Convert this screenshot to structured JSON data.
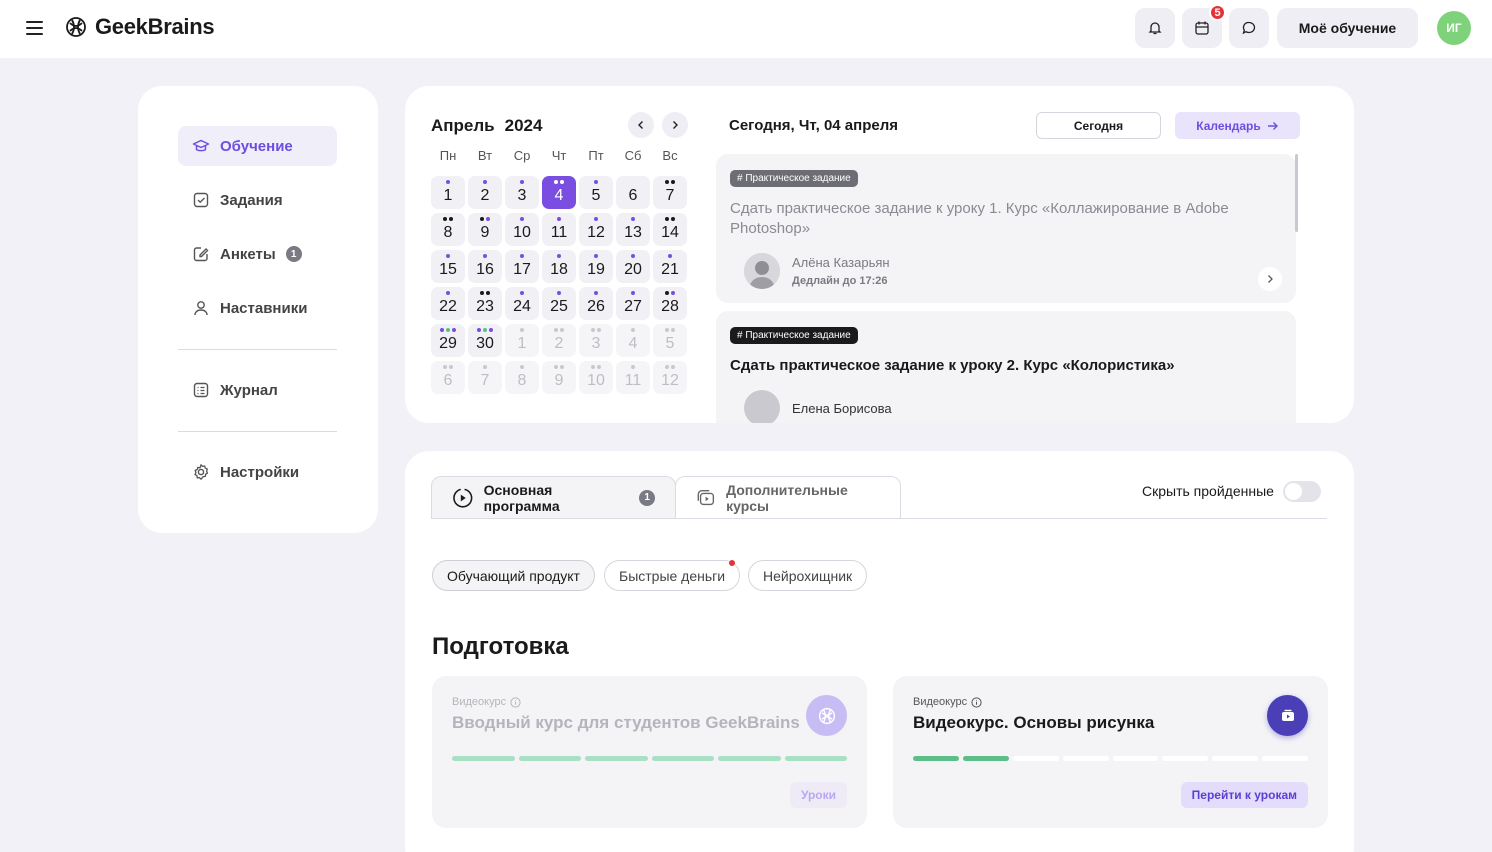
{
  "header": {
    "logo_text": "GeekBrains",
    "notifications_badge": "5",
    "my_learning_label": "Моё обучение",
    "avatar_initials": "ИГ"
  },
  "sidebar": {
    "items": [
      {
        "label": "Обучение",
        "icon": "graduation-cap-icon",
        "active": true
      },
      {
        "label": "Задания",
        "icon": "checkbox-icon"
      },
      {
        "label": "Анкеты",
        "icon": "edit-icon",
        "count": "1"
      },
      {
        "label": "Наставники",
        "icon": "user-icon"
      },
      {
        "label": "Журнал",
        "icon": "journal-icon"
      },
      {
        "label": "Настройки",
        "icon": "gear-icon"
      }
    ]
  },
  "calendar": {
    "month": "Апрель",
    "year": "2024",
    "weekdays": [
      "Пн",
      "Вт",
      "Ср",
      "Чт",
      "Пт",
      "Сб",
      "Вс"
    ],
    "weeks": [
      [
        "1",
        "2",
        "3",
        "4",
        "5",
        "6",
        "7"
      ],
      [
        "8",
        "9",
        "10",
        "11",
        "12",
        "13",
        "14"
      ],
      [
        "15",
        "16",
        "17",
        "18",
        "19",
        "20",
        "21"
      ],
      [
        "22",
        "23",
        "24",
        "25",
        "26",
        "27",
        "28"
      ],
      [
        "29",
        "30",
        "1",
        "2",
        "3",
        "4",
        "5"
      ],
      [
        "6",
        "7",
        "8",
        "9",
        "10",
        "11",
        "12"
      ]
    ],
    "today_day": "4"
  },
  "agenda": {
    "title": "Сегодня, Чт, 04 апреля",
    "today_button": "Сегодня",
    "calendar_button": "Календарь",
    "tasks": [
      {
        "tag": "# Практическое задание",
        "title": "Сдать практическое задание к уроку 1. Курс «Коллажирование в Adobe Photoshop»",
        "author": "Алёна Казарьян",
        "deadline": "Дедлайн до 17:26"
      },
      {
        "tag": "# Практическое задание",
        "title": "Сдать практическое задание к уроку 2. Курс «Колористика»",
        "author": "Елена Борисова"
      }
    ]
  },
  "program": {
    "tabs": [
      {
        "label": "Основная программа",
        "count": "1",
        "icon": "play-circle-icon"
      },
      {
        "label": "Дополнительные курсы",
        "icon": "video-stack-icon"
      }
    ],
    "hide_completed_label": "Скрыть пройденные",
    "chips": [
      "Обучающий продукт",
      "Быстрые деньги",
      "Нейрохищник"
    ],
    "section_title": "Подготовка",
    "courses": [
      {
        "kind": "Видеокурс",
        "title": "Вводный курс для студентов GeekBrains",
        "button": "Уроки",
        "segments_done": 6,
        "segments_total": 6
      },
      {
        "kind": "Видеокурс",
        "title": "Видеокурс. Основы рисунка",
        "button": "Перейти к урокам",
        "segments_done": 2,
        "segments_total": 8
      }
    ]
  },
  "colors": {
    "accent": "#7a4ee0",
    "progress_green": "#5cbf8a",
    "badge_red": "#e5313a"
  }
}
